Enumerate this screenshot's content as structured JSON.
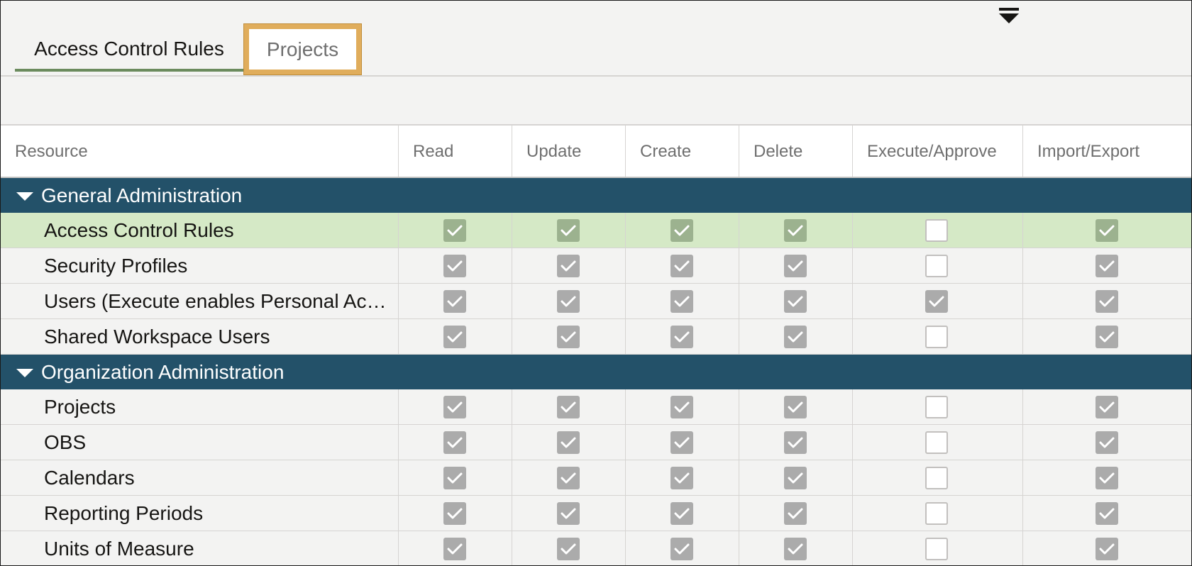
{
  "menu_icon": "overflow-menu-icon",
  "tabs": [
    {
      "label": "Access Control Rules",
      "active": true
    },
    {
      "label": "Projects",
      "active": false
    }
  ],
  "columns": [
    "Resource",
    "Read",
    "Update",
    "Create",
    "Delete",
    "Execute/Approve",
    "Import/Export"
  ],
  "groups": [
    {
      "label": "General Administration",
      "rows": [
        {
          "label": "Access Control Rules",
          "selected": true,
          "checks": [
            true,
            true,
            true,
            true,
            false,
            true
          ]
        },
        {
          "label": "Security Profiles",
          "selected": false,
          "checks": [
            true,
            true,
            true,
            true,
            false,
            true
          ]
        },
        {
          "label": "Users (Execute enables Personal Ac…",
          "selected": false,
          "checks": [
            true,
            true,
            true,
            true,
            true,
            true
          ]
        },
        {
          "label": "Shared Workspace Users",
          "selected": false,
          "checks": [
            true,
            true,
            true,
            true,
            false,
            true
          ]
        }
      ]
    },
    {
      "label": "Organization Administration",
      "rows": [
        {
          "label": "Projects",
          "selected": false,
          "checks": [
            true,
            true,
            true,
            true,
            false,
            true
          ]
        },
        {
          "label": "OBS",
          "selected": false,
          "checks": [
            true,
            true,
            true,
            true,
            false,
            true
          ]
        },
        {
          "label": "Calendars",
          "selected": false,
          "checks": [
            true,
            true,
            true,
            true,
            false,
            true
          ]
        },
        {
          "label": "Reporting Periods",
          "selected": false,
          "checks": [
            true,
            true,
            true,
            true,
            false,
            true
          ]
        },
        {
          "label": "Units of Measure",
          "selected": false,
          "checks": [
            true,
            true,
            true,
            true,
            false,
            true
          ]
        }
      ]
    }
  ]
}
